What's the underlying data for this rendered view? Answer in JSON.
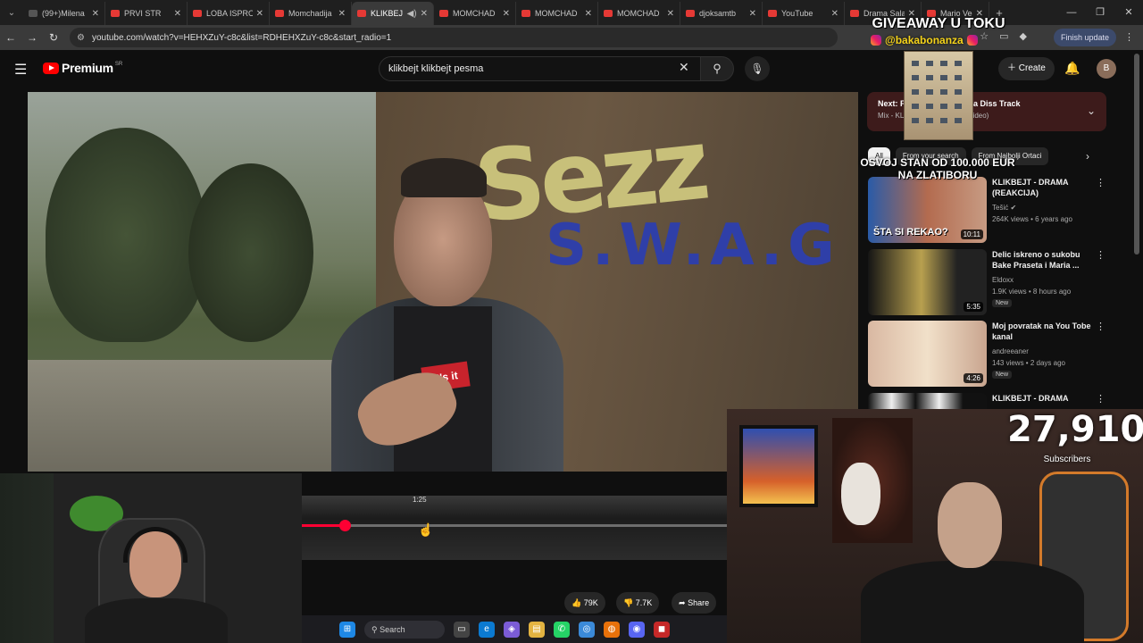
{
  "browser": {
    "tabs": [
      {
        "label": "(99+)Milena",
        "active": false
      },
      {
        "label": "PRVI STR",
        "active": false
      },
      {
        "label": "LOBA ISPRO",
        "active": false
      },
      {
        "label": "Momchadija",
        "active": false
      },
      {
        "label": "KLIKBEJ",
        "active": true
      },
      {
        "label": "MOMCHAD",
        "active": false
      },
      {
        "label": "MOMCHAD",
        "active": false
      },
      {
        "label": "MOMCHAD",
        "active": false
      },
      {
        "label": "djoksamtb",
        "active": false
      },
      {
        "label": "YouTube",
        "active": false
      },
      {
        "label": "Drama Salan",
        "active": false
      },
      {
        "label": "Mario Vedo",
        "active": false
      }
    ],
    "url": "youtube.com/watch?v=HEHXZuY-c8c&list=RDHEHXZuY-c8c&start_radio=1",
    "finish_update": "Finish update"
  },
  "youtube": {
    "logo": "Premium",
    "region": "SR",
    "search_query": "klikbejt klikbejt pesma",
    "create_label": "Create",
    "avatar_letter": "B",
    "next": {
      "prefix": "Next: F",
      "title_tail": "Fedja Diss Track",
      "sub_prefix": "Mix - KL",
      "sub_tail": "Video)"
    },
    "chips": [
      "All",
      "From your search",
      "From Najbolji Ortaci"
    ],
    "suggestions": [
      {
        "title": "KLIKBEJT - DRAMA (REAKCIJA)",
        "channel": "Tešić",
        "meta": "264K views • 6 years ago",
        "duration": "10:11",
        "badge": ""
      },
      {
        "title": "Delic iskreno o sukobu Bake Praseta i Maria ...",
        "channel": "Eldoxx",
        "meta": "1.9K views • 8 hours ago",
        "duration": "5:35",
        "badge": "New"
      },
      {
        "title": "Moj povratak na You Tobe kanal",
        "channel": "andreeaner",
        "meta": "143 views • 2 days ago",
        "duration": "4:26",
        "badge": "New"
      },
      {
        "title": "KLIKBEJT - DRAMA",
        "channel": "",
        "meta": "",
        "duration": "",
        "badge": ""
      }
    ],
    "thumb_caption": "ŠTA SI REKAO?",
    "likes": "79K",
    "dislikes": "7.7K",
    "share": "Share",
    "seek_time": "1:25",
    "progress_fraction": 0.1
  },
  "video": {
    "shirt_logo": "it's it",
    "graffiti_top": "Sezz",
    "graffiti_mid": "S.W.A.G"
  },
  "overlay": {
    "giveaway": "GIVEAWAY U TOKU",
    "handle": "@bakabonanza",
    "promo_line1": "OSVOJ STAN OD 100.000 EUR",
    "promo_line2": "NA ZLATIBORU",
    "subs_count": "27,910",
    "subs_label": "Subscribers"
  },
  "taskbar": {
    "search": "Search"
  }
}
